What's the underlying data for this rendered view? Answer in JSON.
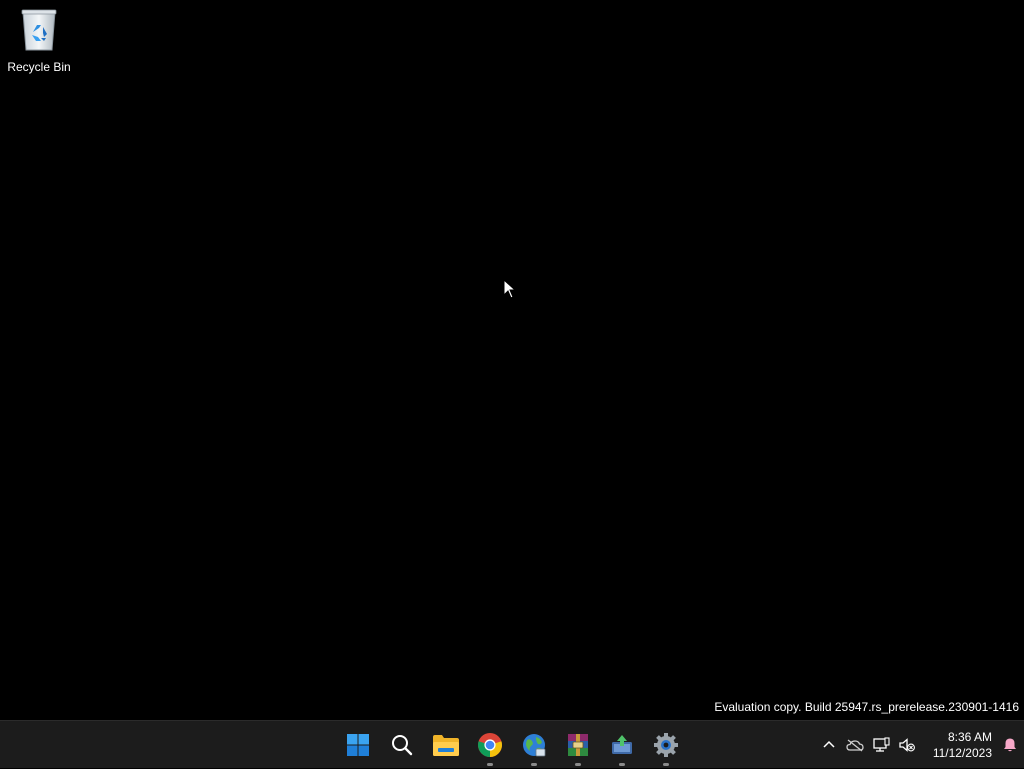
{
  "desktop": {
    "background_color": "#000000",
    "icons": [
      {
        "label": "Recycle Bin",
        "icon": "recycle-bin-icon"
      }
    ],
    "watermark": "Evaluation copy. Build 25947.rs_prerelease.230901-1416"
  },
  "taskbar": {
    "background_color": "#1c1c1c",
    "pinned": [
      {
        "name": "Start",
        "icon": "windows-logo-icon",
        "running": false
      },
      {
        "name": "Search",
        "icon": "search-icon",
        "running": false
      },
      {
        "name": "File Explorer",
        "icon": "folder-icon",
        "running": false
      },
      {
        "name": "Google Chrome",
        "icon": "chrome-icon",
        "running": true
      },
      {
        "name": "Network app",
        "icon": "globe-icon",
        "running": true
      },
      {
        "name": "WinRAR",
        "icon": "winrar-icon",
        "running": true
      },
      {
        "name": "Installer",
        "icon": "installer-icon",
        "running": true
      },
      {
        "name": "Settings",
        "icon": "gear-icon",
        "running": true
      }
    ],
    "tray": {
      "icons": [
        "chevron-up-icon",
        "onedrive-offline-icon",
        "network-icon",
        "volume-muted-icon"
      ],
      "time": "8:36 AM",
      "date": "11/12/2023",
      "notification_icon": "bell-icon",
      "notification_color": "#f7a8c8"
    }
  }
}
